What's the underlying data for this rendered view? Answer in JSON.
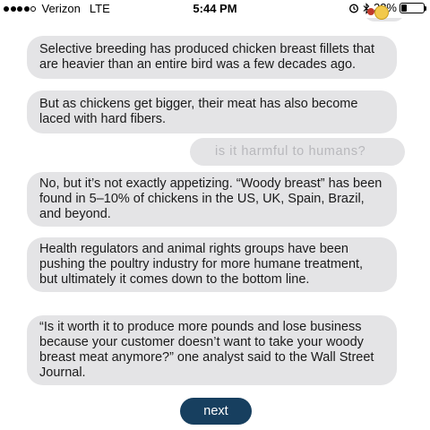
{
  "status_bar": {
    "carrier": "Verizon",
    "network": "LTE",
    "time": "5:44 PM",
    "battery_percent": "23%",
    "battery_level": 0.23,
    "icons": [
      "signal-dots-icon",
      "alarm-icon",
      "bluetooth-icon",
      "battery-icon"
    ]
  },
  "messages": [
    {
      "from": "bot",
      "text": "Selective breeding has produced chicken breast fillets that are heavier than an entire bird was a few decades ago."
    },
    {
      "from": "bot",
      "text": "But as chickens get bigger, their meat has also become laced with hard fibers."
    },
    {
      "from": "user",
      "text": "is it harmful to humans?"
    },
    {
      "from": "bot",
      "text": "No, but it’s not exactly appetizing. “Woody breast” has been found in 5–10% of chickens in the US, UK, Spain, Brazil, and beyond."
    },
    {
      "from": "bot",
      "text": "Health regulators and animal rights groups have been pushing the poultry industry for more humane treatment, but ultimately it comes down to the bottom line."
    },
    {
      "from": "bot",
      "text": "“Is it worth it to produce more pounds and lose business because your customer doesn’t want to take your woody breast meat anymore?” one analyst said to the Wall Street Journal."
    }
  ],
  "next_button": {
    "label": "next"
  },
  "colors": {
    "bubble_bg": "#e4e4e6",
    "bubble_text": "#1a1a1a",
    "user_text": "#b8b8bc",
    "button_bg": "#173f5f",
    "button_text": "#ffffff"
  }
}
